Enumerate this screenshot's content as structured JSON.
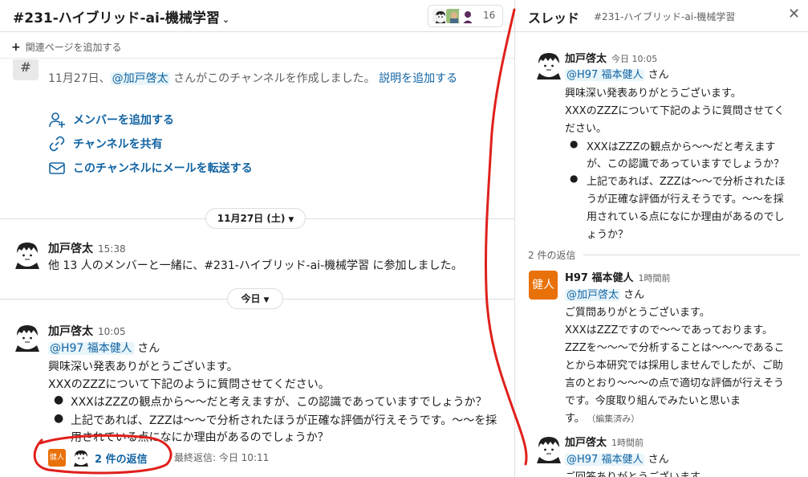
{
  "channel": {
    "title": "#231-ハイブリッド-ai-機械学習",
    "title_chevron": "⌄",
    "member_count": "16",
    "add_bookmark": "関連ページを追加する"
  },
  "intro": {
    "hash": "#",
    "clipped_text": "・・・・・・・・・・・・・・・・・・・・・・・・・・・・・・・・・・・・・・・・",
    "created_date": "11月27日、",
    "created_mention": "@加戸啓太",
    "created_rest": " さんがこのチャンネルを作成しました。",
    "add_description": "説明を追加する",
    "actions": [
      {
        "label": "メンバーを追加する",
        "icon": "add-person-icon"
      },
      {
        "label": "チャンネルを共有",
        "icon": "link-icon"
      },
      {
        "label": "このチャンネルにメールを転送する",
        "icon": "mail-forward-icon"
      }
    ]
  },
  "date_dividers": {
    "nov27": "11月27日 (土)",
    "today": "今日"
  },
  "join_message": {
    "author": "加戸啓太",
    "time": "15:38",
    "text": "他 13 人のメンバーと一緒に、#231-ハイブリッド-ai-機械学習 に参加しました。"
  },
  "main_message": {
    "author": "加戸啓太",
    "time": "10:05",
    "mention": "@H97 福本健人",
    "mention_suffix": " さん",
    "line1": "興味深い発表ありがとうございます。",
    "line2": "XXXのZZZについて下記のように質問させてください。",
    "bullet1": "XXXはZZZの観点から〜〜だと考えますが、この認識であっていますでしょうか？",
    "bullet2_a": "上記であれば、ZZZは〜〜で分析されたほうが正確な評価が行えそうです。〜〜を採",
    "bullet2_b": "用されている点になにか理由があるのでしょうか？",
    "reply_avatar_text": "健人",
    "reply_count": "2 件の返信",
    "reply_last": "最終返信: 今日 10:11"
  },
  "thread": {
    "title": "スレッド",
    "subtitle": "#231-ハイブリッド-ai-機械学習",
    "close": "✕",
    "parent": {
      "author": "加戸啓太",
      "time": "今日 10:05",
      "mention": "@H97 福本健人",
      "mention_suffix": " さん",
      "lines": [
        "興味深い発表ありがとうございます。",
        "XXXのZZZについて下記のように質問させてく",
        "ださい。"
      ],
      "bullet1": [
        "XXXはZZZの観点から〜〜だと考えます",
        "が、この認識であっていますでしょうか？"
      ],
      "bullet2": [
        "上記であれば、ZZZは〜〜で分析されたほ",
        "うが正確な評価が行えそうです。〜〜を採",
        "用されている点になにか理由があるのでし",
        "ょうか？"
      ]
    },
    "reply_separator": "2 件の返信",
    "reply1": {
      "avatar_text": "健人",
      "author": "H97 福本健人",
      "time": "1時間前",
      "mention": "@加戸啓太",
      "mention_suffix": " さん",
      "lines": [
        "ご質問ありがとうございます。",
        "XXXはZZZですので〜〜であっております。",
        "ZZZを〜〜〜で分析することは〜〜〜であるこ",
        "とから本研究では採用しませんでしたが、ご助",
        "言のとおり〜〜〜の点で適切な評価が行えそう",
        "です。今度取り組んでみたいと思いま",
        "す。"
      ],
      "edited": "（編集済み）"
    },
    "reply2": {
      "author": "加戸啓太",
      "time": "1時間前",
      "mention": "@H97 福本健人",
      "mention_suffix": " さん",
      "line1": "ご回答ありがとうございます。"
    }
  },
  "colors": {
    "link": "#1264a3",
    "mention_bg": "#e8f5fa",
    "ken_orange": "#e8710a",
    "annotation_red": "#e0201c"
  }
}
